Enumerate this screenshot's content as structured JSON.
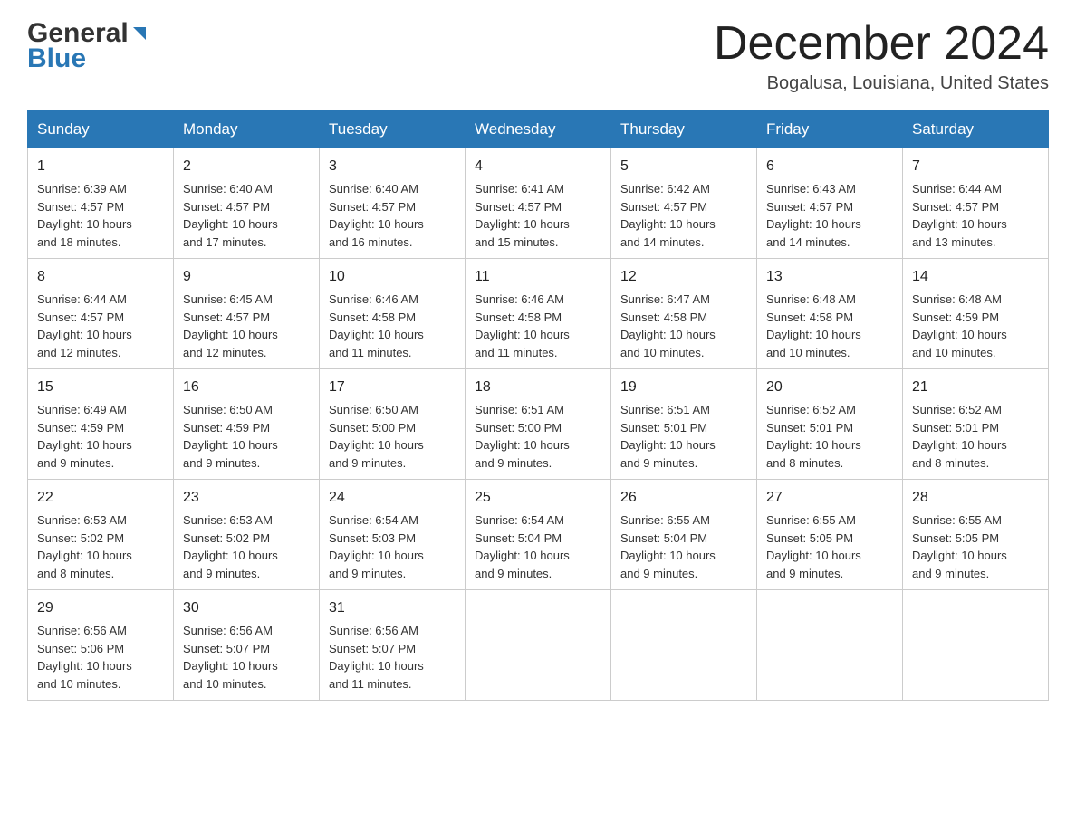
{
  "header": {
    "logo_general": "General",
    "logo_blue": "Blue",
    "month_title": "December 2024",
    "location": "Bogalusa, Louisiana, United States"
  },
  "days_of_week": [
    "Sunday",
    "Monday",
    "Tuesday",
    "Wednesday",
    "Thursday",
    "Friday",
    "Saturday"
  ],
  "weeks": [
    [
      {
        "day": "1",
        "sunrise": "6:39 AM",
        "sunset": "4:57 PM",
        "daylight": "10 hours and 18 minutes."
      },
      {
        "day": "2",
        "sunrise": "6:40 AM",
        "sunset": "4:57 PM",
        "daylight": "10 hours and 17 minutes."
      },
      {
        "day": "3",
        "sunrise": "6:40 AM",
        "sunset": "4:57 PM",
        "daylight": "10 hours and 16 minutes."
      },
      {
        "day": "4",
        "sunrise": "6:41 AM",
        "sunset": "4:57 PM",
        "daylight": "10 hours and 15 minutes."
      },
      {
        "day": "5",
        "sunrise": "6:42 AM",
        "sunset": "4:57 PM",
        "daylight": "10 hours and 14 minutes."
      },
      {
        "day": "6",
        "sunrise": "6:43 AM",
        "sunset": "4:57 PM",
        "daylight": "10 hours and 14 minutes."
      },
      {
        "day": "7",
        "sunrise": "6:44 AM",
        "sunset": "4:57 PM",
        "daylight": "10 hours and 13 minutes."
      }
    ],
    [
      {
        "day": "8",
        "sunrise": "6:44 AM",
        "sunset": "4:57 PM",
        "daylight": "10 hours and 12 minutes."
      },
      {
        "day": "9",
        "sunrise": "6:45 AM",
        "sunset": "4:57 PM",
        "daylight": "10 hours and 12 minutes."
      },
      {
        "day": "10",
        "sunrise": "6:46 AM",
        "sunset": "4:58 PM",
        "daylight": "10 hours and 11 minutes."
      },
      {
        "day": "11",
        "sunrise": "6:46 AM",
        "sunset": "4:58 PM",
        "daylight": "10 hours and 11 minutes."
      },
      {
        "day": "12",
        "sunrise": "6:47 AM",
        "sunset": "4:58 PM",
        "daylight": "10 hours and 10 minutes."
      },
      {
        "day": "13",
        "sunrise": "6:48 AM",
        "sunset": "4:58 PM",
        "daylight": "10 hours and 10 minutes."
      },
      {
        "day": "14",
        "sunrise": "6:48 AM",
        "sunset": "4:59 PM",
        "daylight": "10 hours and 10 minutes."
      }
    ],
    [
      {
        "day": "15",
        "sunrise": "6:49 AM",
        "sunset": "4:59 PM",
        "daylight": "10 hours and 9 minutes."
      },
      {
        "day": "16",
        "sunrise": "6:50 AM",
        "sunset": "4:59 PM",
        "daylight": "10 hours and 9 minutes."
      },
      {
        "day": "17",
        "sunrise": "6:50 AM",
        "sunset": "5:00 PM",
        "daylight": "10 hours and 9 minutes."
      },
      {
        "day": "18",
        "sunrise": "6:51 AM",
        "sunset": "5:00 PM",
        "daylight": "10 hours and 9 minutes."
      },
      {
        "day": "19",
        "sunrise": "6:51 AM",
        "sunset": "5:01 PM",
        "daylight": "10 hours and 9 minutes."
      },
      {
        "day": "20",
        "sunrise": "6:52 AM",
        "sunset": "5:01 PM",
        "daylight": "10 hours and 8 minutes."
      },
      {
        "day": "21",
        "sunrise": "6:52 AM",
        "sunset": "5:01 PM",
        "daylight": "10 hours and 8 minutes."
      }
    ],
    [
      {
        "day": "22",
        "sunrise": "6:53 AM",
        "sunset": "5:02 PM",
        "daylight": "10 hours and 8 minutes."
      },
      {
        "day": "23",
        "sunrise": "6:53 AM",
        "sunset": "5:02 PM",
        "daylight": "10 hours and 9 minutes."
      },
      {
        "day": "24",
        "sunrise": "6:54 AM",
        "sunset": "5:03 PM",
        "daylight": "10 hours and 9 minutes."
      },
      {
        "day": "25",
        "sunrise": "6:54 AM",
        "sunset": "5:04 PM",
        "daylight": "10 hours and 9 minutes."
      },
      {
        "day": "26",
        "sunrise": "6:55 AM",
        "sunset": "5:04 PM",
        "daylight": "10 hours and 9 minutes."
      },
      {
        "day": "27",
        "sunrise": "6:55 AM",
        "sunset": "5:05 PM",
        "daylight": "10 hours and 9 minutes."
      },
      {
        "day": "28",
        "sunrise": "6:55 AM",
        "sunset": "5:05 PM",
        "daylight": "10 hours and 9 minutes."
      }
    ],
    [
      {
        "day": "29",
        "sunrise": "6:56 AM",
        "sunset": "5:06 PM",
        "daylight": "10 hours and 10 minutes."
      },
      {
        "day": "30",
        "sunrise": "6:56 AM",
        "sunset": "5:07 PM",
        "daylight": "10 hours and 10 minutes."
      },
      {
        "day": "31",
        "sunrise": "6:56 AM",
        "sunset": "5:07 PM",
        "daylight": "10 hours and 11 minutes."
      },
      null,
      null,
      null,
      null
    ]
  ],
  "labels": {
    "sunrise": "Sunrise:",
    "sunset": "Sunset:",
    "daylight": "Daylight:"
  }
}
